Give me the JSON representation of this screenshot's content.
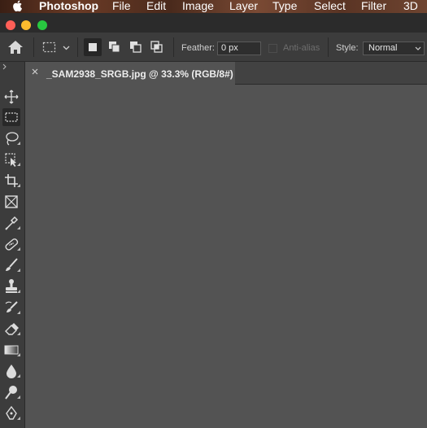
{
  "menubar": {
    "app_name": "Photoshop",
    "items": [
      "File",
      "Edit",
      "Image",
      "Layer",
      "Type",
      "Select",
      "Filter",
      "3D"
    ]
  },
  "options_bar": {
    "feather_label": "Feather:",
    "feather_value": "0 px",
    "antialias_label": "Anti-alias",
    "style_label": "Style:",
    "style_value": "Normal"
  },
  "document_tab": {
    "title": "_SAM2938_SRGB.jpg @ 33.3% (RGB/8#)"
  },
  "tools": [
    "move-tool-icon",
    "rectangular-marquee-tool-icon",
    "lasso-tool-icon",
    "object-selection-tool-icon",
    "crop-tool-icon",
    "frame-tool-icon",
    "eyedropper-tool-icon",
    "spot-healing-brush-tool-icon",
    "brush-tool-icon",
    "clone-stamp-tool-icon",
    "history-brush-tool-icon",
    "eraser-tool-icon",
    "gradient-tool-icon",
    "blur-tool-icon",
    "dodge-tool-icon",
    "pen-tool-icon"
  ],
  "colors": {
    "canvas": "#535353",
    "panel": "#3c3c3c",
    "traffic_red": "#fe5f57",
    "traffic_yellow": "#febc2e",
    "traffic_green": "#28c840"
  }
}
